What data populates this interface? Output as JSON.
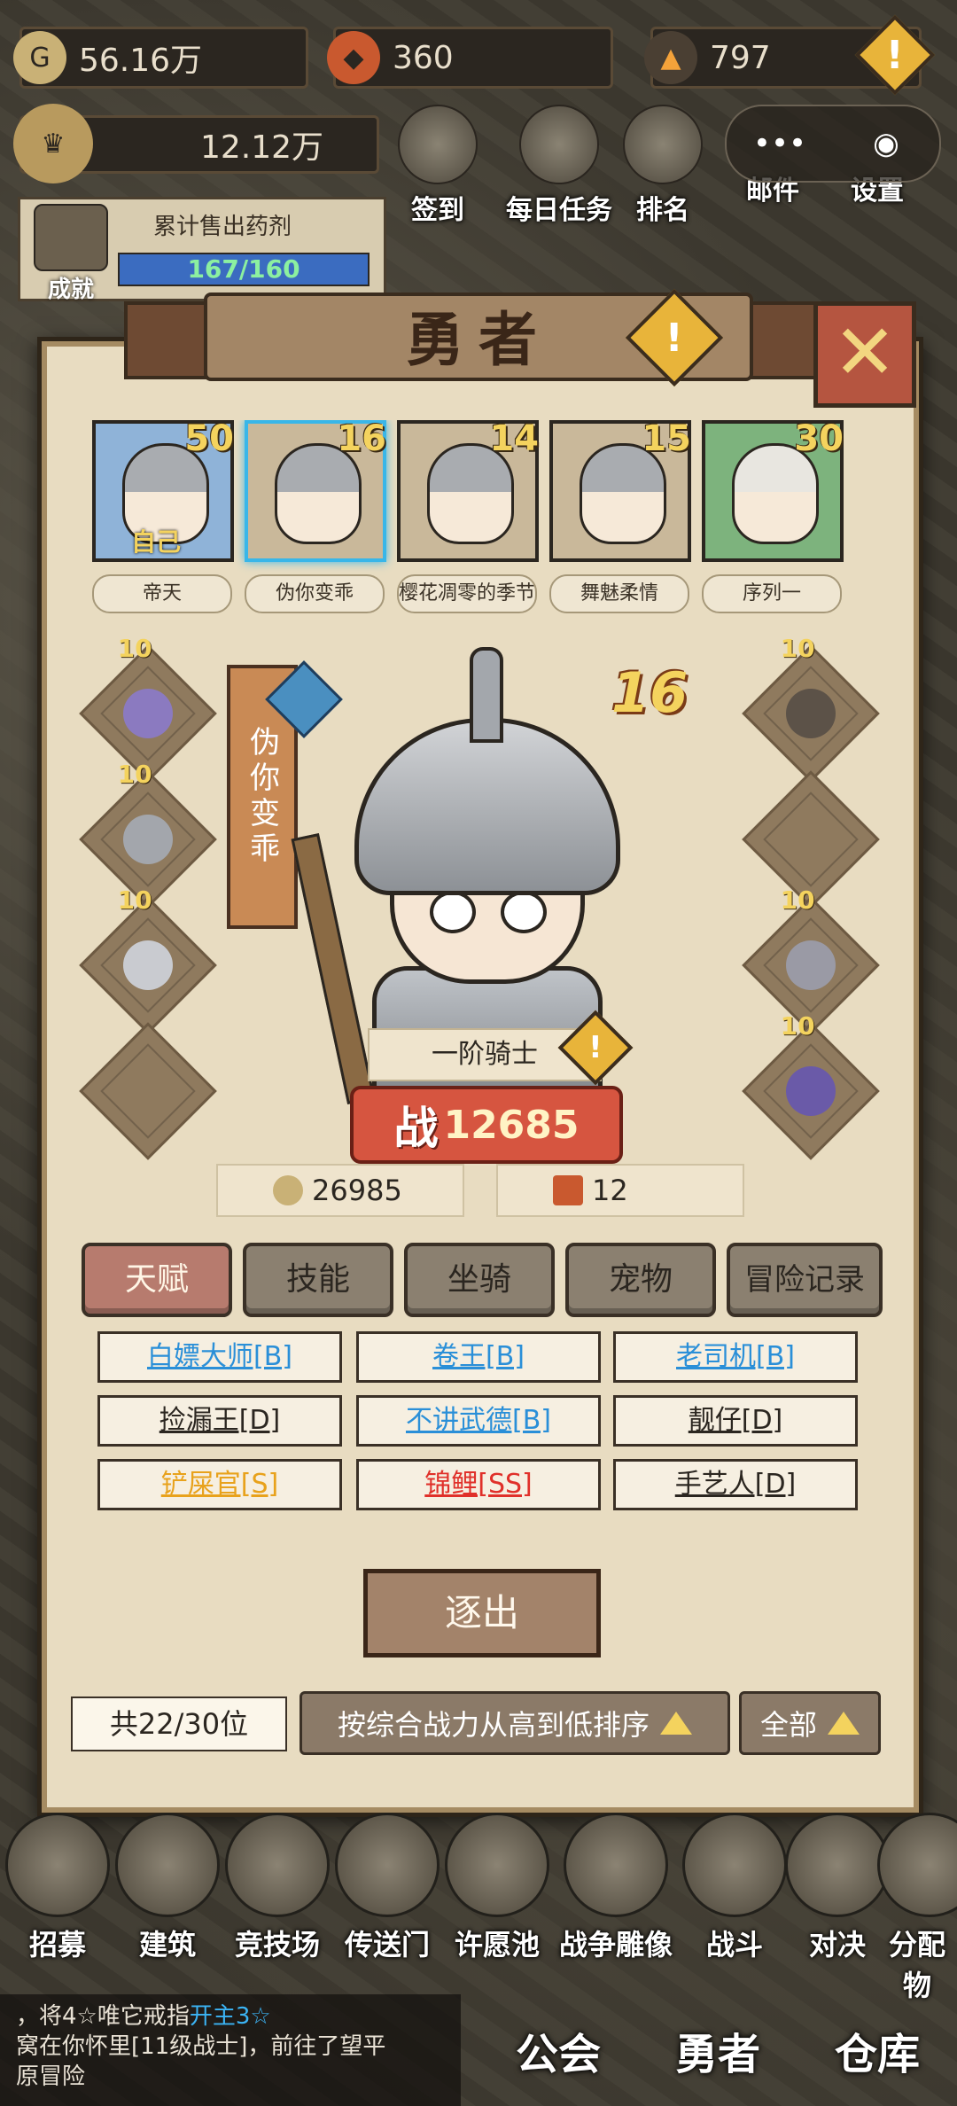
{
  "resources": {
    "gold": "56.16万",
    "gem": "360",
    "energy": "797",
    "power_total": "12.12万"
  },
  "top_menu": [
    {
      "label": "签到",
      "icon": "quill-icon"
    },
    {
      "label": "每日任务",
      "icon": "scroll-icon"
    },
    {
      "label": "排名",
      "icon": "crown-icon"
    },
    {
      "label": "邮件",
      "icon": "mail-icon"
    },
    {
      "label": "设置",
      "icon": "gear-icon"
    }
  ],
  "miniprogram": {
    "more": "•••",
    "close": "◉"
  },
  "achievement": {
    "label": "成就",
    "progress_title": "累计售出药剂",
    "progress_text": "167/160",
    "progress": 1.0
  },
  "panel": {
    "title": "勇者",
    "close": "✕",
    "warn": "!"
  },
  "heroes": [
    {
      "name": "帝天",
      "level": "50",
      "tag": "自己",
      "color": "#8fb3d8",
      "selected": false
    },
    {
      "name": "伪你变乖",
      "level": "16",
      "tag": "",
      "color": "#c9b89a",
      "selected": true
    },
    {
      "name": "樱花凋零的季节",
      "level": "14",
      "tag": "",
      "color": "#c9b89a",
      "selected": false
    },
    {
      "name": "舞魅柔情",
      "level": "15",
      "tag": "",
      "color": "#c9b89a",
      "selected": false
    },
    {
      "name": "序列一",
      "level": "30",
      "tag": "",
      "color": "#7db37d",
      "selected": false
    }
  ],
  "selected_hero": {
    "name": "伪你变乖",
    "level": "16",
    "rank": "一阶骑士",
    "power_label": "战",
    "power": "12685",
    "gold": "26985",
    "tickets": "12"
  },
  "equip_left": [
    {
      "level": "10",
      "icon": "sword-icon"
    },
    {
      "level": "10",
      "icon": "armor-icon"
    },
    {
      "level": "10",
      "icon": "helmet-icon"
    },
    {
      "level": "",
      "icon": "empty-slot-icon"
    }
  ],
  "equip_right": [
    {
      "level": "10",
      "icon": "necklace-icon"
    },
    {
      "level": "",
      "icon": "empty-slot-icon"
    },
    {
      "level": "10",
      "icon": "ring-icon"
    },
    {
      "level": "10",
      "icon": "cape-icon"
    }
  ],
  "tabs": [
    "天赋",
    "技能",
    "坐骑",
    "宠物",
    "冒险记录"
  ],
  "talents": [
    {
      "label": "白嫖大师[B]",
      "color": "#2a8fd8"
    },
    {
      "label": "卷王[B]",
      "color": "#2a8fd8"
    },
    {
      "label": "老司机[B]",
      "color": "#2a8fd8"
    },
    {
      "label": "捡漏王[D]",
      "color": "#2b2620"
    },
    {
      "label": "不讲武德[B]",
      "color": "#2a8fd8"
    },
    {
      "label": "靓仔[D]",
      "color": "#2b2620"
    },
    {
      "label": "铲屎官[S]",
      "color": "#e8a21c"
    },
    {
      "label": "锦鲤[SS]",
      "color": "#e0302a"
    },
    {
      "label": "手艺人[D]",
      "color": "#2b2620"
    }
  ],
  "expel": "逐出",
  "count": "共22/30位",
  "sort": "按综合战力从高到低排序",
  "filter": "全部",
  "bottom_menu": [
    "招募",
    "建筑",
    "竞技场",
    "传送门",
    "许愿池",
    "战争雕像",
    "战斗",
    "对决",
    "分配物"
  ],
  "chat": {
    "line1": "，将4☆唯它戒指",
    "line1_hl": "开主3☆",
    "line2": "窝在你怀里[11级战士]，前往了望平",
    "line3": "原冒险"
  },
  "main_nav": [
    "公会",
    "勇者",
    "仓库"
  ]
}
